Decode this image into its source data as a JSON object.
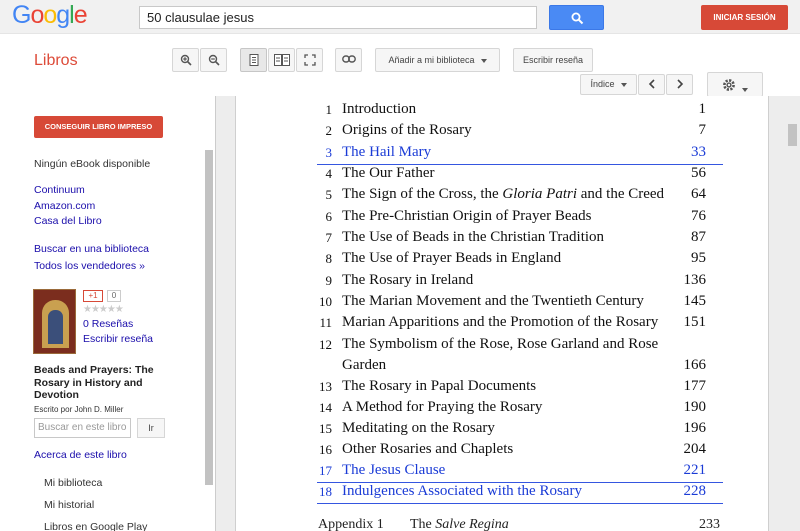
{
  "header": {
    "logo": [
      {
        "ch": "G",
        "color": "#4285f4"
      },
      {
        "ch": "o",
        "color": "#ea4335"
      },
      {
        "ch": "o",
        "color": "#fbbc05"
      },
      {
        "ch": "g",
        "color": "#4285f4"
      },
      {
        "ch": "l",
        "color": "#34a853"
      },
      {
        "ch": "e",
        "color": "#ea4335"
      }
    ],
    "search_value": "50 clausulae jesus",
    "signin_label": "INICIAR SESIÓN"
  },
  "toolbar": {
    "section_title": "Libros",
    "add_library_label": "Añadir a mi biblioteca",
    "write_review_label": "Escribir reseña",
    "index_label": "Índice"
  },
  "left_panel": {
    "buy_print_label": "CONSEGUIR LIBRO IMPRESO",
    "no_ebook": "Ningún eBook disponible",
    "sellers": [
      "Continuum",
      "Amazon.com",
      "Casa del Libro"
    ],
    "find_library": "Buscar en una biblioteca",
    "all_sellers": "Todos los vendedores »",
    "gplus_label": "+1",
    "gplus_count": "0",
    "stars": "★★★★★",
    "reviews_label": "0 Reseñas",
    "write_review": "Escribir reseña",
    "book_title": "Beads and Prayers: The Rosary in History and Devotion",
    "author": "Escrito por John D. Miller",
    "search_placeholder": "Buscar en este libro",
    "search_go": "Ir",
    "about_book": "Acerca de este libro",
    "menu": [
      "Mi biblioteca",
      "Mi historial",
      "Libros en Google Play"
    ]
  },
  "toc": {
    "entries": [
      {
        "num": "1",
        "title": "Introduction",
        "page": "1",
        "highlight": false
      },
      {
        "num": "2",
        "title": "Origins of the Rosary",
        "page": "7",
        "highlight": false
      },
      {
        "num": "3",
        "title": "The Hail Mary",
        "page": "33",
        "highlight": true
      },
      {
        "num": "4",
        "title": "The Our Father",
        "page": "56",
        "highlight": false
      },
      {
        "num": "5",
        "title": "The Sign of the Cross, the Gloria Patri and the Creed",
        "page": "64",
        "highlight": false
      },
      {
        "num": "6",
        "title": "The Pre-Christian Origin of Prayer Beads",
        "page": "76",
        "highlight": false
      },
      {
        "num": "7",
        "title": "The Use of Beads in the Christian Tradition",
        "page": "87",
        "highlight": false
      },
      {
        "num": "8",
        "title": "The Use of Prayer Beads in England",
        "page": "95",
        "highlight": false
      },
      {
        "num": "9",
        "title": "The Rosary in Ireland",
        "page": "136",
        "highlight": false
      },
      {
        "num": "10",
        "title": "The Marian Movement and the Twentieth Century",
        "page": "145",
        "highlight": false
      },
      {
        "num": "11",
        "title": "Marian Apparitions and the Promotion of the Rosary",
        "page": "151",
        "highlight": false
      },
      {
        "num": "12",
        "title": "The Symbolism of the Rose, Rose Garland and Rose",
        "page": "",
        "highlight": false
      },
      {
        "num": "",
        "title": "Garden",
        "page": "166",
        "highlight": false
      },
      {
        "num": "13",
        "title": "The Rosary in Papal Documents",
        "page": "177",
        "highlight": false
      },
      {
        "num": "14",
        "title": "A Method for Praying the Rosary",
        "page": "190",
        "highlight": false
      },
      {
        "num": "15",
        "title": "Meditating on the Rosary",
        "page": "196",
        "highlight": false
      },
      {
        "num": "16",
        "title": "Other Rosaries and Chaplets",
        "page": "204",
        "highlight": false
      },
      {
        "num": "17",
        "title": "The Jesus Clause",
        "page": "221",
        "highlight": true
      },
      {
        "num": "18",
        "title": "Indulgences Associated with the Rosary",
        "page": "228",
        "highlight": true
      }
    ],
    "appendix": {
      "label": "Appendix 1",
      "title": "The Salve Regina",
      "page": "233"
    }
  }
}
